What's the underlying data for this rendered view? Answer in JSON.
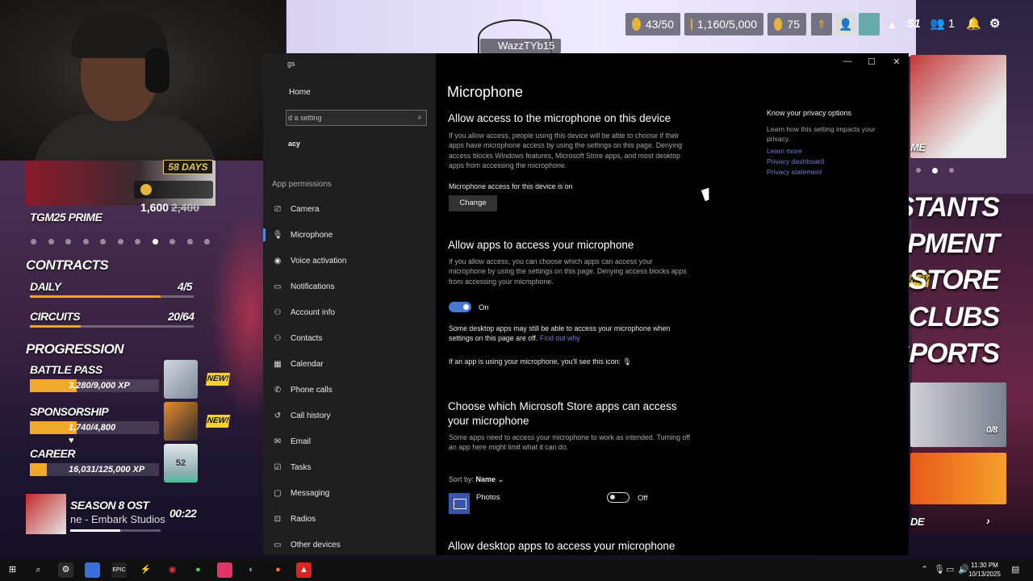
{
  "game": {
    "hud": {
      "energy": "43/50",
      "currency": "1,160/5,000",
      "coins": "75",
      "level": "51",
      "friends": "1",
      "username": "WazzTYb15"
    },
    "prime": {
      "days": "58 DAYS",
      "price": "1,600",
      "old_price": "2,400",
      "title": "TGM25 PRIME"
    },
    "contracts": {
      "title": "CONTRACTS",
      "daily_label": "DAILY",
      "daily_value": "4/5",
      "daily_progress": 0.8,
      "circuits_label": "CIRCUITS",
      "circuits_value": "20/64",
      "circuits_progress": 0.31
    },
    "progression": {
      "title": "PROGRESSION",
      "battle_pass_label": "BATTLE PASS",
      "battle_pass_xp": "3,280/9,000 XP",
      "battle_pass_progress": 0.36,
      "sponsorship_label": "SPONSORSHIP",
      "sponsorship_xp": "1,740/4,800",
      "sponsorship_progress": 0.36,
      "career_label": "CAREER",
      "career_xp": "16,031/125,000 XP",
      "career_progress": 0.13,
      "career_rank": "52",
      "new_badge": "NEW!"
    },
    "music": {
      "title": "SEASON 8 OST",
      "artist": "ne - Embark Studios",
      "time": "00:22"
    },
    "right_menu": {
      "top_label": "ME",
      "contestants": "TESTANTS",
      "equipment": "UIPMENT",
      "store": "STORE",
      "clubs": "CLUBS",
      "esports": "ESPORTS",
      "new_badge": "NEW!",
      "card_count": "0/8",
      "bottom_label": "DE"
    }
  },
  "settings": {
    "nav": {
      "window_title": "gs",
      "home": "Home",
      "search_placeholder": "d a setting",
      "section": "acy",
      "permissions_header": "App permissions",
      "items": [
        {
          "label": "Camera",
          "icon": "camera-icon",
          "glyph": "⎚"
        },
        {
          "label": "Microphone",
          "icon": "microphone-icon",
          "glyph": "🎙"
        },
        {
          "label": "Voice activation",
          "icon": "voice-activation-icon",
          "glyph": "◉"
        },
        {
          "label": "Notifications",
          "icon": "notifications-icon",
          "glyph": "▭"
        },
        {
          "label": "Account info",
          "icon": "account-info-icon",
          "glyph": "⚇"
        },
        {
          "label": "Contacts",
          "icon": "contacts-icon",
          "glyph": "⚇"
        },
        {
          "label": "Calendar",
          "icon": "calendar-icon",
          "glyph": "▦"
        },
        {
          "label": "Phone calls",
          "icon": "phone-calls-icon",
          "glyph": "✆"
        },
        {
          "label": "Call history",
          "icon": "call-history-icon",
          "glyph": "↺"
        },
        {
          "label": "Email",
          "icon": "email-icon",
          "glyph": "✉"
        },
        {
          "label": "Tasks",
          "icon": "tasks-icon",
          "glyph": "☑"
        },
        {
          "label": "Messaging",
          "icon": "messaging-icon",
          "glyph": "▢"
        },
        {
          "label": "Radios",
          "icon": "radios-icon",
          "glyph": "⊡"
        },
        {
          "label": "Other devices",
          "icon": "other-devices-icon",
          "glyph": "▭"
        }
      ]
    },
    "content": {
      "title": "Microphone",
      "section1_heading": "Allow access to the microphone on this device",
      "section1_body": "If you allow access, people using this device will be able to choose if their apps have microphone access by using the settings on this page. Denying access blocks Windows features, Microsoft Store apps, and most desktop apps from accessing the microphone.",
      "device_status": "Microphone access for this device is on",
      "change_button": "Change",
      "section2_heading": "Allow apps to access your microphone",
      "section2_body": "If you allow access, you can choose which apps can access your microphone by using the settings on this page. Denying access blocks apps from accessing your microphone.",
      "apps_toggle_label": "On",
      "desktop_note": "Some desktop apps may still be able to access your microphone when settings on this page are off.",
      "find_out_why": "Find out why",
      "icon_note": "If an app is using your microphone, you'll see this icon:",
      "section3_heading": "Choose which Microsoft Store apps can access your microphone",
      "section3_body": "Some apps need to access your microphone to work as intended. Turning off an app here might limit what it can do.",
      "sort_label": "Sort by:",
      "sort_value": "Name",
      "app_name": "Photos",
      "app_toggle_label": "Off",
      "section4_heading": "Allow desktop apps to access your microphone"
    },
    "side": {
      "heading": "Know your privacy options",
      "body": "Learn how this setting impacts your privacy.",
      "link1": "Learn more",
      "link2": "Privacy dashboard",
      "link3": "Privacy statement"
    }
  },
  "taskbar": {
    "time": "11:30 PM",
    "date": "10/13/2025"
  },
  "colors": {
    "accent": "#4a79d1",
    "link": "#6f7fd6",
    "game_gold": "#f3a425"
  }
}
